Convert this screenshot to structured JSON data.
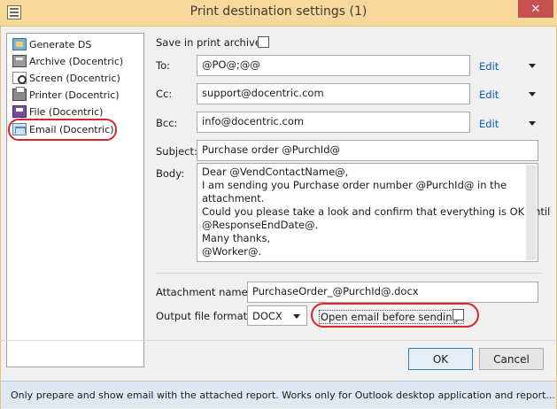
{
  "window": {
    "title": "Print destination settings (1)",
    "close_label": "✕"
  },
  "destinations": [
    {
      "label": "Generate DS",
      "icon": "data-source-icon"
    },
    {
      "label": "Archive (Docentric)",
      "icon": "archive-icon"
    },
    {
      "label": "Screen (Docentric)",
      "icon": "screen-preview-icon"
    },
    {
      "label": "Printer (Docentric)",
      "icon": "printer-icon"
    },
    {
      "label": "File (Docentric)",
      "icon": "file-icon"
    },
    {
      "label": "Email (Docentric)",
      "icon": "email-icon"
    }
  ],
  "form": {
    "archive_label": "Save in print archive?",
    "to_label": "To:",
    "to_value": "@PO@;@@",
    "cc_label": "Cc:",
    "cc_value": "support@docentric.com",
    "bcc_label": "Bcc:",
    "bcc_value": "info@docentric.com",
    "edit_label": "Edit",
    "subject_label": "Subject:",
    "subject_value": "Purchase order @PurchId@",
    "body_label": "Body:",
    "body_lines": [
      "Dear @VendContactName@,",
      "I am sending you Purchase order number @PurchId@ in the",
      "attachment.",
      "Could you please take a look and confirm that everything is OK until",
      "@ResponseEndDate@.",
      "Many thanks,",
      "@Worker@."
    ],
    "attachment_label": "Attachment name:",
    "attachment_value": "PurchaseOrder_@PurchId@.docx",
    "format_label": "Output file format:",
    "format_value": "DOCX",
    "open_email_label": "Open email before sending:"
  },
  "buttons": {
    "ok": "OK",
    "cancel": "Cancel"
  },
  "status": "Only prepare and show email with the attached report. Works only for Outlook desktop application and report...",
  "colors": {
    "highlight_oval": "#d8262c",
    "title_bar": "#f5d89a",
    "link": "#0b5dc2"
  }
}
